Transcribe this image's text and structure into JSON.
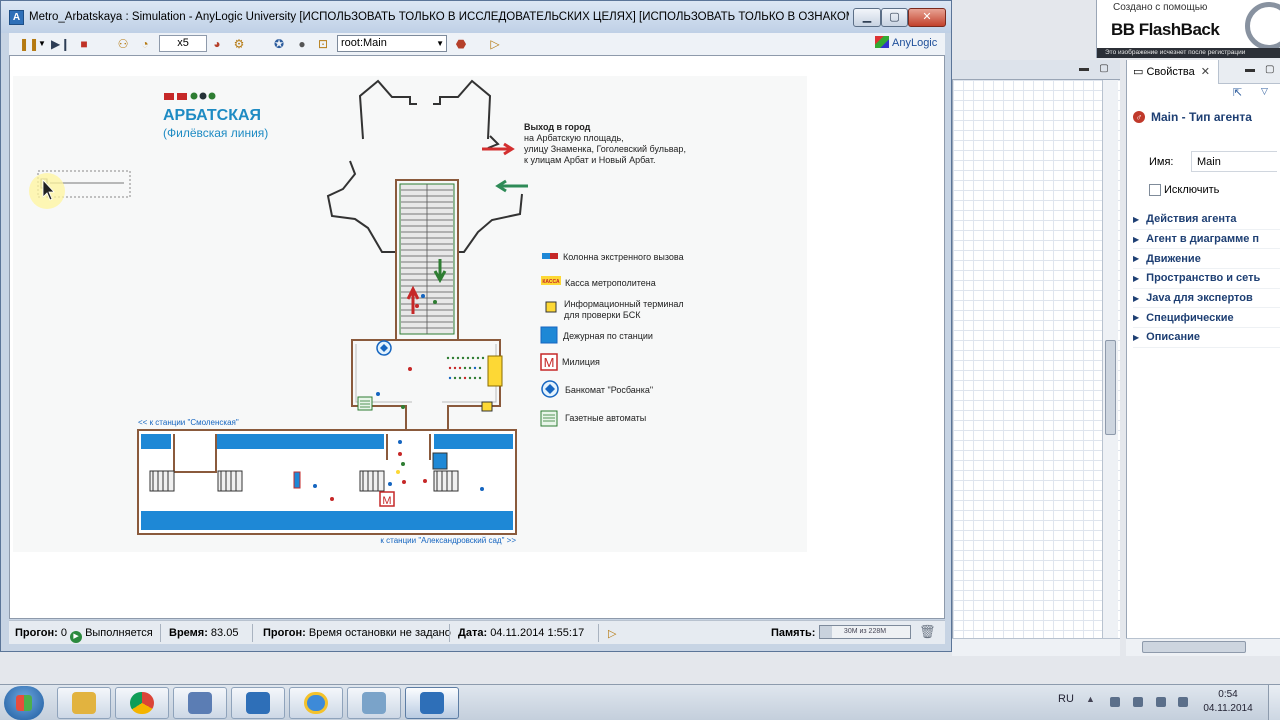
{
  "window": {
    "title": "Metro_Arbatskaya : Simulation - AnyLogic University  [ИСПОЛЬЗОВАТЬ ТОЛЬКО В ИССЛЕДОВАТЕЛЬСКИХ ЦЕЛЯХ]  [ИСПОЛЬЗОВАТЬ ТОЛЬКО В ОЗНАКОМИТ..."
  },
  "toolbar": {
    "speed": "x5",
    "view_selector": "root:Main",
    "brand": "AnyLogic"
  },
  "station": {
    "logo_text": "АРБАТСКАЯ",
    "line": "(Филёвская линия)",
    "exit_title": "Выход в город",
    "exit_line1": "на Арбатскую площадь,",
    "exit_line2": "улицу Знаменка, Гоголевский бульвар,",
    "exit_line3": "к улицам Арбат и Новый Арбат.",
    "to_smolenskaya": "<< к станции \"Смоленская\"",
    "to_aleksandrovsky": "к станции \"Александровский сад\" >>",
    "legend": [
      {
        "icon": "emergency-call-icon",
        "label": "Колонна экстренного вызова"
      },
      {
        "icon": "ticket-office-icon",
        "label": "Касса метрополитена"
      },
      {
        "icon": "info-terminal-icon",
        "label": "Информационный терминал",
        "label2": "для проверки БСК"
      },
      {
        "icon": "station-duty-icon",
        "label": "Дежурная по станции"
      },
      {
        "icon": "police-icon",
        "label": "Милиция"
      },
      {
        "icon": "atm-icon",
        "label": "Банкомат \"Росбанка\""
      },
      {
        "icon": "newspaper-machine-icon",
        "label": "Газетные автоматы"
      }
    ],
    "kassa_label": "КАССА"
  },
  "status": {
    "run_label": "Прогон:",
    "run_value": "0",
    "run_state": "Выполняется",
    "time_label": "Время:",
    "time_value": "83.05",
    "stop_label": "Прогон:",
    "stop_value": "Время остановки не задано",
    "date_label": "Дата:",
    "date_value": "04.11.2014 1:55:17",
    "memory_label": "Память:",
    "memory_text": "30M из 228M",
    "memory_fraction": 0.13
  },
  "properties": {
    "tab": "Свойства",
    "title": "Main - Тип агента",
    "name_label": "Имя:",
    "name_value": "Main",
    "exclude_label": "Исключить",
    "sections": [
      "Действия агента",
      "Агент в диаграмме п",
      "Движение",
      "Пространство и сеть",
      "Java для экспертов",
      "Специфические",
      "Описание"
    ]
  },
  "watermark": {
    "created": "Создано с помощью",
    "brand": "BB FlashBack",
    "note": "Это изображение исчезнет после регистрации"
  },
  "taskbar": {
    "lang": "RU",
    "time": "0:54",
    "date": "04.11.2014"
  },
  "colors": {
    "platform_blue": "#1e88d6",
    "wall_brown": "#8a5a3c",
    "title_blue": "#1e8bc3",
    "exit_arrow_red": "#d32f2f",
    "enter_arrow_green": "#2e8b57"
  }
}
